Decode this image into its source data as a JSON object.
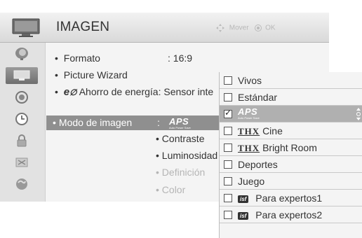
{
  "header": {
    "title": "IMAGEN",
    "hint_move": "Mover",
    "hint_ok": "OK",
    "icon": "tv-icon"
  },
  "sidebar": {
    "items": [
      {
        "icon": "satellite-dish-icon"
      },
      {
        "icon": "tv-picture-icon",
        "active": true
      },
      {
        "icon": "speaker-audio-icon"
      },
      {
        "icon": "clock-icon"
      },
      {
        "icon": "lock-icon"
      },
      {
        "icon": "options-icon"
      },
      {
        "icon": "network-globe-icon"
      }
    ]
  },
  "menu": {
    "formato_label": "Formato",
    "formato_value": ": 16:9",
    "wizard_label": "Picture Wizard",
    "energy_logo": "e",
    "energy_label": "Ahorro de energía: Sensor inte",
    "mode_label": "Modo de imagen",
    "mode_colon": ":",
    "mode_value_logo": "APS",
    "mode_value_small": "Auto Power Save",
    "sub_items": [
      {
        "label": "• Contraste",
        "dim": false
      },
      {
        "label": "• Luminosidad",
        "dim": false
      },
      {
        "label": "• Definición",
        "dim": true
      },
      {
        "label": "• Color",
        "dim": true
      }
    ]
  },
  "dropdown": {
    "options": [
      {
        "label": "Vivos",
        "checked": false
      },
      {
        "label": "Estándar",
        "checked": false
      },
      {
        "label": "APS",
        "sublabel": "Auto Power Save",
        "checked": true
      },
      {
        "prefix": "THX",
        "label": "Cine",
        "checked": false
      },
      {
        "prefix": "THX",
        "label": "Bright Room",
        "checked": false
      },
      {
        "label": "Deportes",
        "checked": false
      },
      {
        "label": "Juego",
        "checked": false
      },
      {
        "badge": "isf",
        "label": "Para expertos1",
        "checked": false
      },
      {
        "badge": "isf",
        "label": "Para expertos2",
        "checked": false
      }
    ]
  },
  "colors": {
    "selected_row": "#8f8f8f",
    "selected_option": "#b0b0b0",
    "header_text": "#333333",
    "dim_text": "#b5b5b5"
  }
}
